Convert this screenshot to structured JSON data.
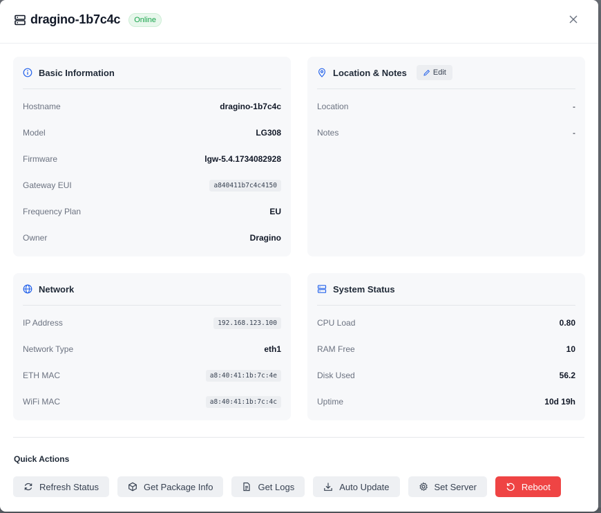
{
  "header": {
    "title": "dragino-1b7c4c",
    "status": "Online",
    "icons": {
      "title": "server-icon",
      "close": "close-icon"
    }
  },
  "basic_info": {
    "title": "Basic Information",
    "icon": "info-icon",
    "rows": [
      {
        "label": "Hostname",
        "value": "dragino-1b7c4c"
      },
      {
        "label": "Model",
        "value": "LG308"
      },
      {
        "label": "Firmware",
        "value": "lgw-5.4.1734082928"
      },
      {
        "label": "Gateway EUI",
        "value": "a840411b7c4c4150"
      },
      {
        "label": "Frequency Plan",
        "value": "EU"
      },
      {
        "label": "Owner",
        "value": "Dragino"
      }
    ]
  },
  "location": {
    "title": "Location & Notes",
    "icon": "map-pin-icon",
    "edit_label": "Edit",
    "rows": [
      {
        "label": "Location",
        "value": "-"
      },
      {
        "label": "Notes",
        "value": "-"
      }
    ]
  },
  "network": {
    "title": "Network",
    "icon": "globe-icon",
    "rows": [
      {
        "label": "IP Address",
        "value": "192.168.123.100"
      },
      {
        "label": "Network Type",
        "value": "eth1"
      },
      {
        "label": "ETH MAC",
        "value": "a8:40:41:1b:7c:4e"
      },
      {
        "label": "WiFi MAC",
        "value": "a8:40:41:1b:7c:4c"
      }
    ]
  },
  "system": {
    "title": "System Status",
    "icon": "server-icon",
    "rows": [
      {
        "label": "CPU Load",
        "value": "0.80"
      },
      {
        "label": "RAM Free",
        "value": "10"
      },
      {
        "label": "Disk Used",
        "value": "56.2"
      },
      {
        "label": "Uptime",
        "value": "10d 19h"
      }
    ]
  },
  "quick_actions": {
    "title": "Quick Actions",
    "buttons": [
      {
        "label": "Refresh Status",
        "icon": "refresh-icon"
      },
      {
        "label": "Get Package Info",
        "icon": "package-icon"
      },
      {
        "label": "Get Logs",
        "icon": "file-text-icon"
      },
      {
        "label": "Auto Update",
        "icon": "download-icon"
      },
      {
        "label": "Set Server",
        "icon": "settings-icon"
      },
      {
        "label": "Reboot",
        "icon": "rotate-ccw-icon"
      }
    ]
  },
  "colors": {
    "online_badge": "#16a34a",
    "danger": "#ef4444",
    "accent": "#2563eb"
  }
}
